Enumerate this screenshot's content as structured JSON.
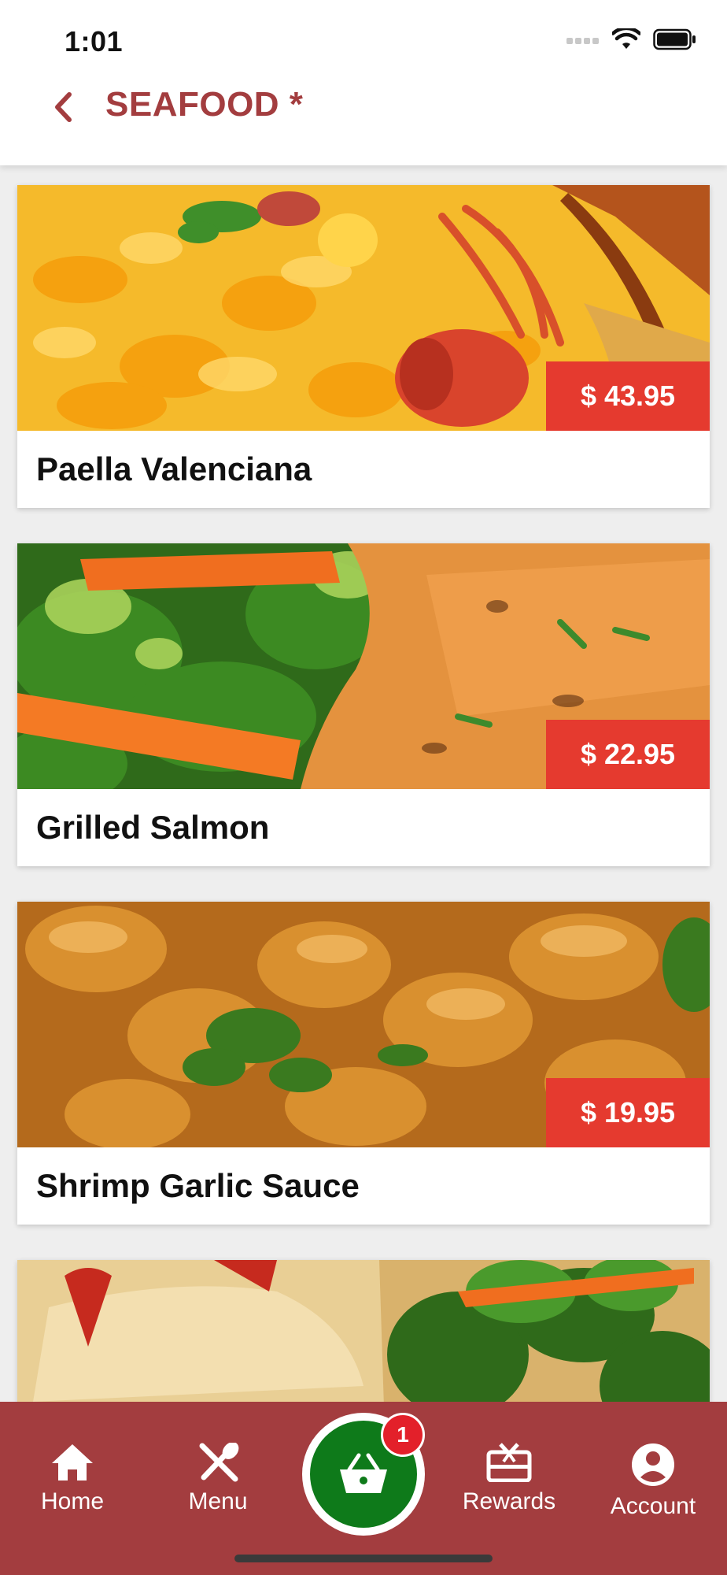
{
  "status_bar": {
    "time": "1:01"
  },
  "header": {
    "title": "SEAFOOD *"
  },
  "items": [
    {
      "name": "Paella Valenciana",
      "price": "$ 43.95"
    },
    {
      "name": "Grilled Salmon",
      "price": "$ 22.95"
    },
    {
      "name": "Shrimp Garlic Sauce",
      "price": "$ 19.95"
    },
    {
      "name": "",
      "price": ""
    }
  ],
  "bottom_nav": {
    "home": "Home",
    "menu": "Menu",
    "rewards": "Rewards",
    "account": "Account",
    "cart_count": "1"
  },
  "colors": {
    "brand": "#a33d3f",
    "price_tag": "#e53a2f",
    "cart": "#0e7a1a",
    "badge": "#e3202a"
  }
}
